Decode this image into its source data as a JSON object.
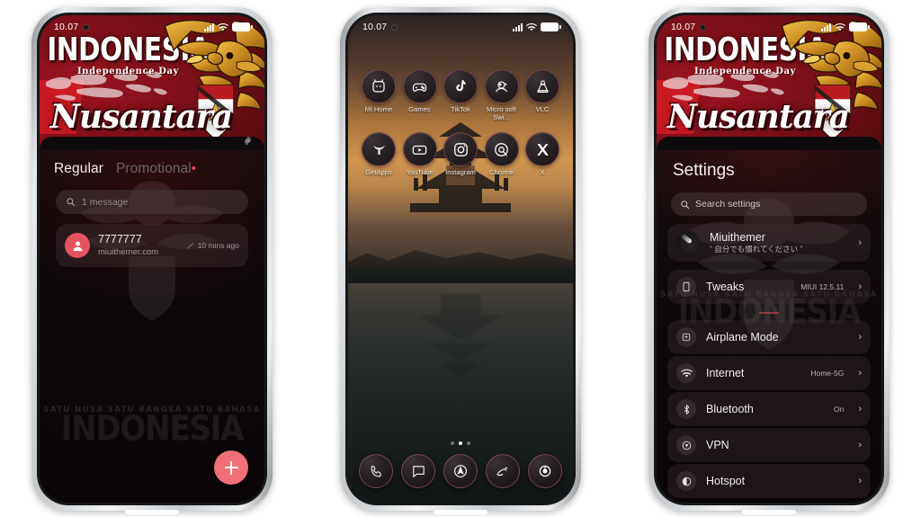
{
  "canvas": {
    "background": "#ffffff",
    "accent_red": "#e5535f",
    "banner_red": "#8e1119"
  },
  "phone1": {
    "status": {
      "time": "10.07",
      "signal_icon": "cellular-signal-icon",
      "wifi_icon": "wifi-icon",
      "battery_icon": "battery-icon"
    },
    "banner": {
      "title": "INDONESIA",
      "subtitle": "Independence Day",
      "word": "Nusantara",
      "emblem_icon": "garuda-eagle-icon",
      "gear_icon": "gear-icon"
    },
    "tabs": [
      {
        "label": "Regular",
        "active": true,
        "badge": ""
      },
      {
        "label": "Promotional",
        "active": false,
        "badge": "•"
      }
    ],
    "search": {
      "icon": "search-icon",
      "placeholder": "1 message"
    },
    "message": {
      "avatar_icon": "person-avatar-icon",
      "name": "7777777",
      "preview": "miuithemer.com",
      "status_icon": "sent-check-icon",
      "time": "10 mins ago"
    },
    "watermark": {
      "line1": "SATU NUSA   SATU BANGSA   SATU BAHASA",
      "line2": "INDONESIA"
    },
    "fab": {
      "icon": "plus-icon",
      "label": "New conversation"
    }
  },
  "phone2": {
    "status": {
      "time": "10.07",
      "signal_icon": "cellular-signal-icon",
      "wifi_icon": "wifi-icon",
      "battery_icon": "battery-icon"
    },
    "wallpaper": "balinese-temple-sunset-reflection",
    "apps_row1": [
      {
        "label": "Mi Home",
        "icon": "mi-home-icon"
      },
      {
        "label": "Games",
        "icon": "gamepad-icon"
      },
      {
        "label": "TikTok",
        "icon": "tiktok-note-icon"
      },
      {
        "label": "Micro soft Swi...",
        "icon": "microsoft-swiftkey-icon"
      },
      {
        "label": "VLC",
        "icon": "vlc-cone-icon"
      }
    ],
    "apps_row2": [
      {
        "label": "GetApps",
        "icon": "getapps-icon"
      },
      {
        "label": "YouTube",
        "icon": "youtube-play-icon"
      },
      {
        "label": "Instagram",
        "icon": "instagram-camera-icon"
      },
      {
        "label": "Chrome",
        "icon": "chrome-icon"
      },
      {
        "label": "X",
        "icon": "x-twitter-icon"
      }
    ],
    "page_dots": {
      "count": 3,
      "active_index": 1
    },
    "dock": [
      {
        "label": "Phone",
        "icon": "phone-handset-icon"
      },
      {
        "label": "Messages",
        "icon": "message-bubble-icon"
      },
      {
        "label": "Browser",
        "icon": "compass-browser-icon"
      },
      {
        "label": "Contacts",
        "icon": "contacts-icon"
      },
      {
        "label": "Camera",
        "icon": "camera-lens-icon"
      }
    ]
  },
  "phone3": {
    "status": {
      "time": "10.07",
      "signal_icon": "cellular-signal-icon",
      "wifi_icon": "wifi-icon",
      "battery_icon": "battery-icon"
    },
    "banner": {
      "title": "INDONESIA",
      "subtitle": "Independence Day",
      "word": "Nusantara",
      "emblem_icon": "garuda-eagle-icon"
    },
    "page_title": "Settings",
    "search": {
      "icon": "search-icon",
      "placeholder": "Search settings"
    },
    "profile": {
      "avatar_icon": "profile-avatar-icon",
      "name": "Miuithemer",
      "subtitle": "ˮ 自分でも慣れてください ˮ",
      "chevron": "›"
    },
    "rows": [
      {
        "label": "Tweaks",
        "value": "MIUI 12.5.11",
        "icon": "phone-device-icon",
        "chevron": "›"
      },
      {
        "label": "Airplane Mode",
        "value": "",
        "icon": "airplane-mode-icon",
        "chevron": "›"
      },
      {
        "label": "Internet",
        "value": "Home-5G",
        "icon": "wifi-icon",
        "chevron": "›"
      },
      {
        "label": "Bluetooth",
        "value": "On",
        "icon": "bluetooth-icon",
        "chevron": "›"
      },
      {
        "label": "VPN",
        "value": "",
        "icon": "vpn-shield-icon",
        "chevron": "›"
      },
      {
        "label": "Hotspot",
        "value": "",
        "icon": "hotspot-icon",
        "chevron": "›"
      }
    ],
    "watermark": {
      "line1": "SATU NUSA   SATU BANGSA   SATU BAHASA",
      "line2": "INDONESIA"
    }
  }
}
